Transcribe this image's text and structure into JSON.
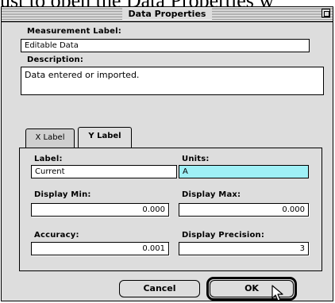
{
  "background_text": "ust to open the Data Properties w",
  "window": {
    "title": "Data Properties"
  },
  "measurement": {
    "label_caption": "Measurement Label:",
    "label_value": "Editable Data",
    "description_caption": "Description:",
    "description_value": "Data entered or imported."
  },
  "tabs": [
    {
      "label": "X Label",
      "active": false
    },
    {
      "label": "Y Label",
      "active": true
    }
  ],
  "panel": {
    "label_caption": "Label:",
    "label_value": "Current",
    "units_caption": "Units:",
    "units_value": "A",
    "display_min_caption": "Display Min:",
    "display_min_value": "0.000",
    "display_max_caption": "Display Max:",
    "display_max_value": "0.000",
    "accuracy_caption": "Accuracy:",
    "accuracy_value": "0.001",
    "precision_caption": "Display Precision:",
    "precision_value": "3"
  },
  "buttons": {
    "cancel": "Cancel",
    "ok": "OK"
  },
  "colors": {
    "highlight_field": "#9ff0f6",
    "window_bg": "#dddddd"
  },
  "icons": {
    "zoom": "zoom-box-icon",
    "cursor": "arrow-cursor-icon"
  }
}
